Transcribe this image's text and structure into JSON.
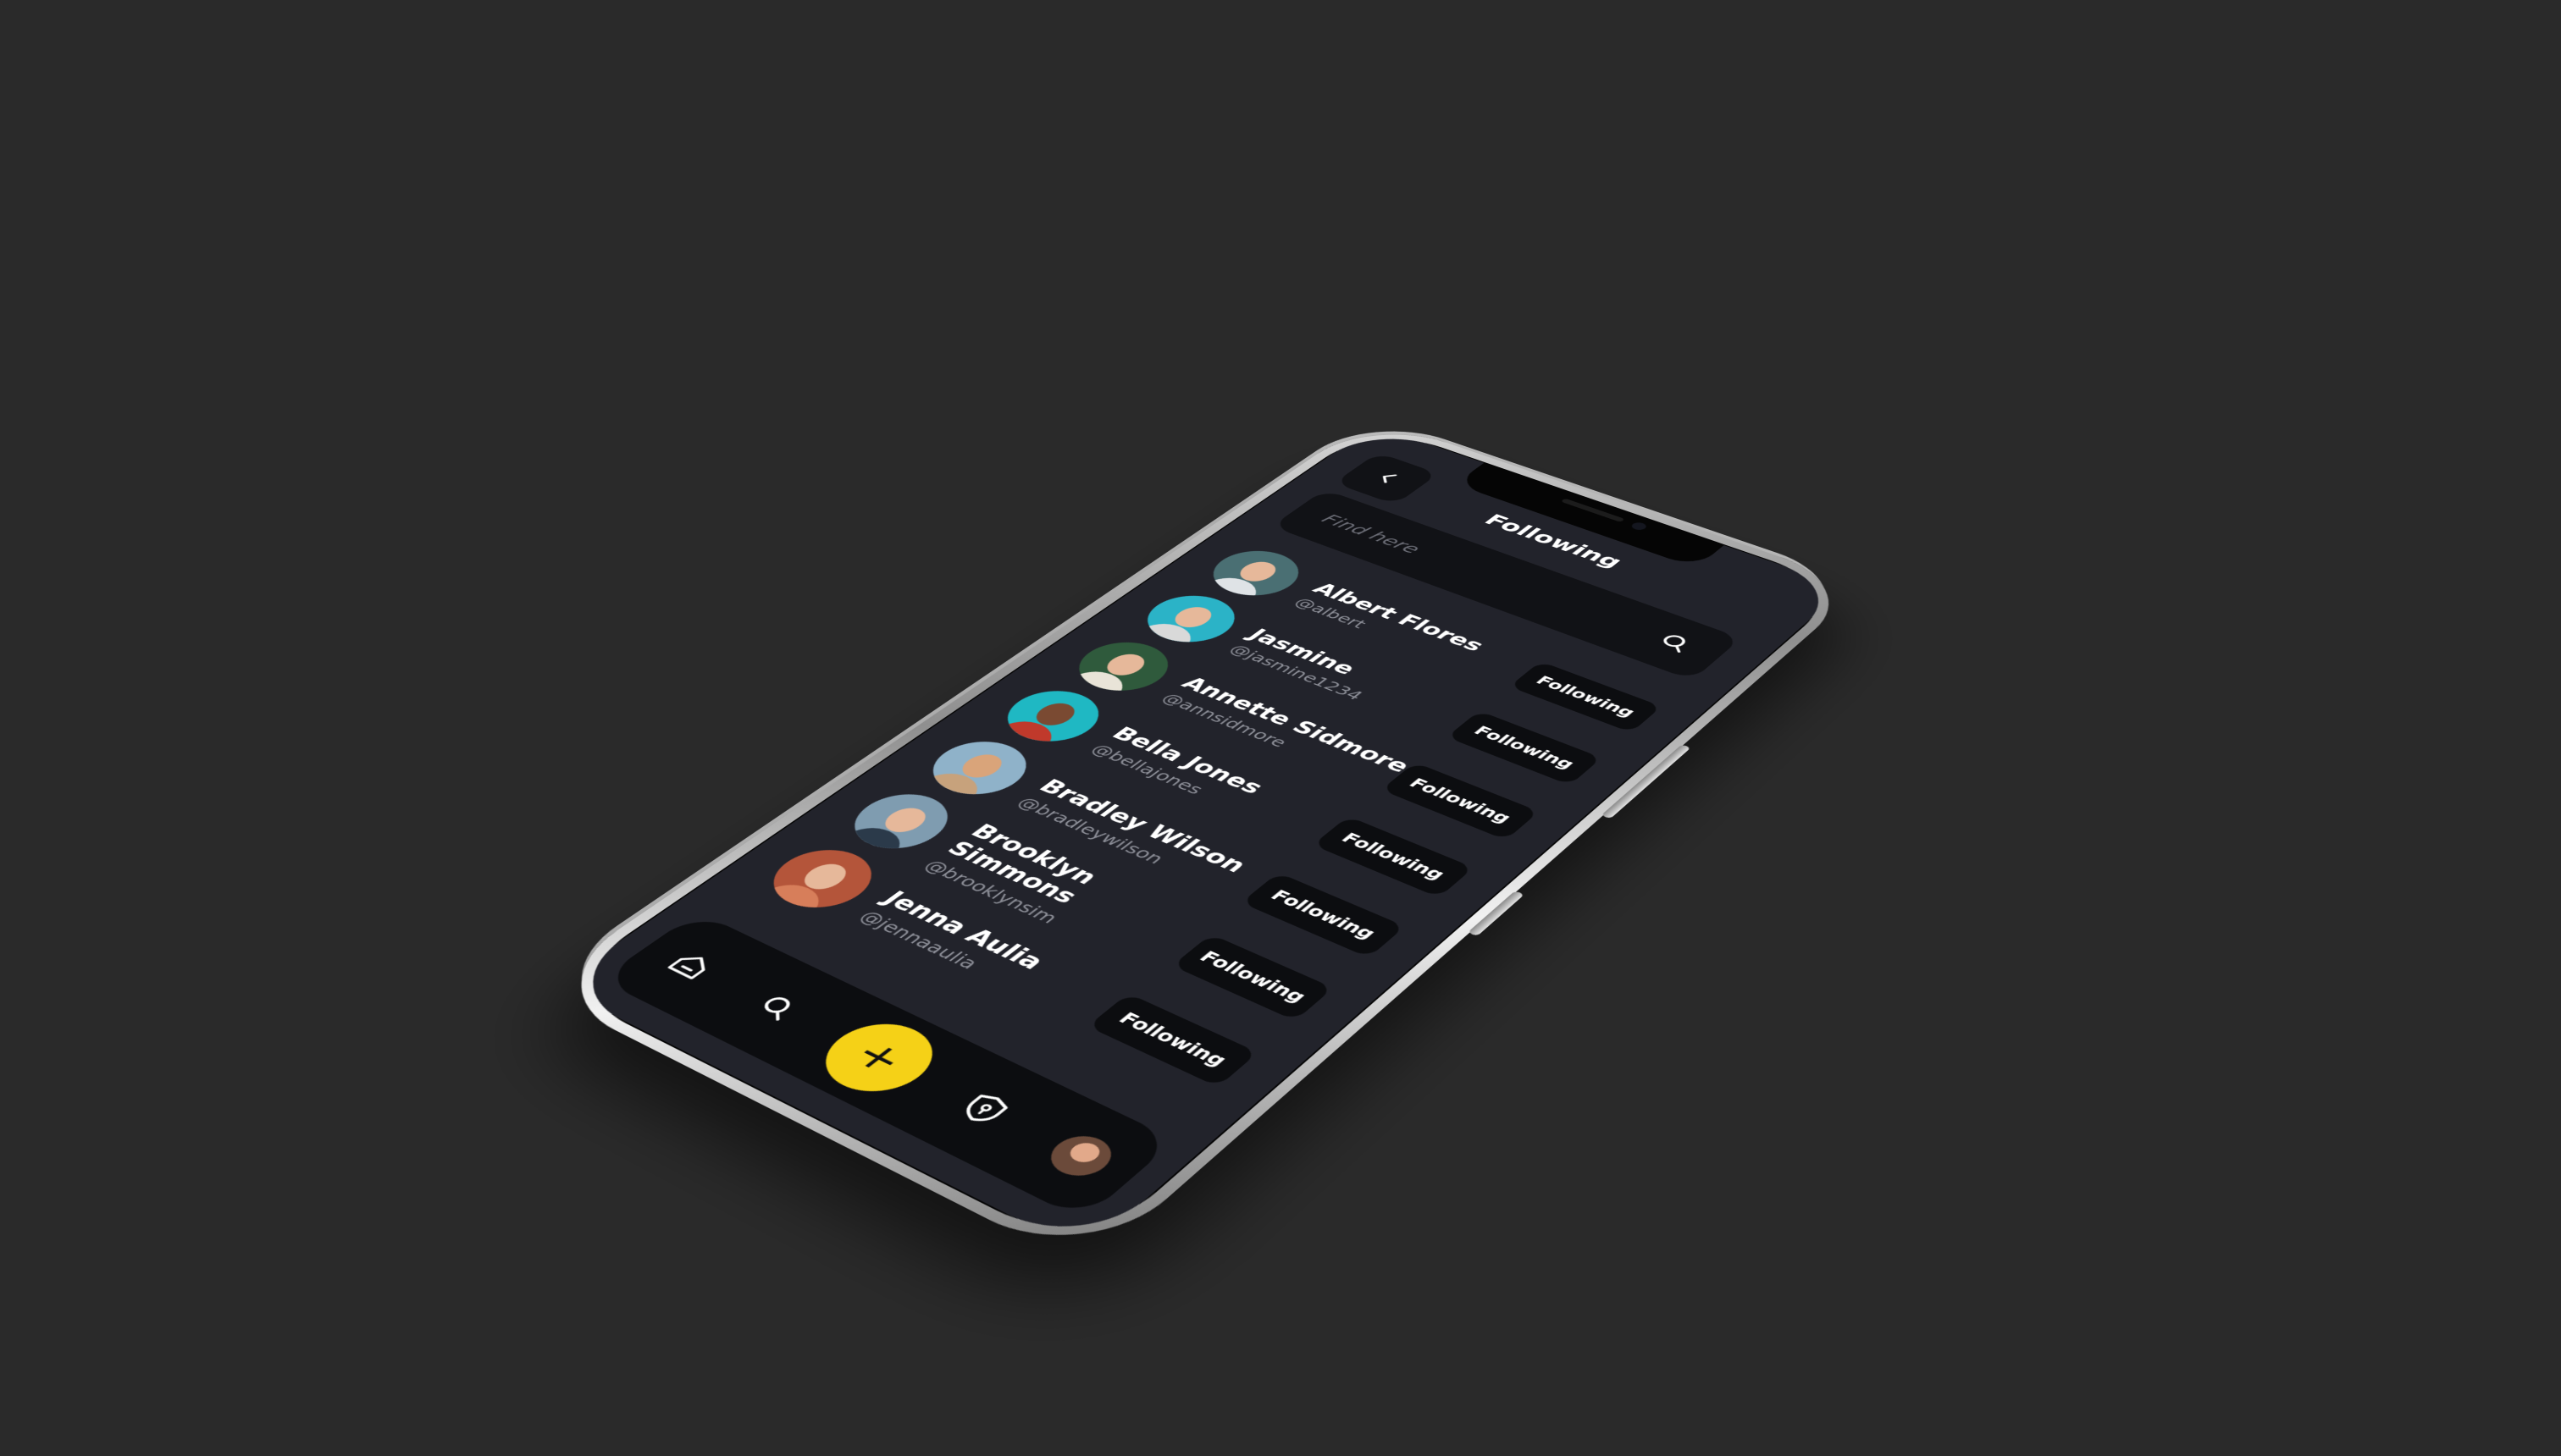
{
  "header": {
    "title": "Following",
    "back_label": "<"
  },
  "search": {
    "placeholder": "Find here"
  },
  "users": [
    {
      "name": "Albert Flores",
      "handle": "@albert",
      "button": "Following",
      "bg": "#4a6f73",
      "shirt": "#dfe3e6"
    },
    {
      "name": "Jasmine",
      "handle": "@jasmine1234",
      "button": "Following",
      "bg": "#2bb3c7",
      "shirt": "#d9d9d9"
    },
    {
      "name": "Annette Sidmore",
      "handle": "@annsidmore",
      "button": "Following",
      "bg": "#2f5a3c",
      "shirt": "#e9e4d8"
    },
    {
      "name": "Bella Jones",
      "handle": "@bellajones",
      "button": "Following",
      "bg": "#1fb8c3",
      "shirt": "#c0392b"
    },
    {
      "name": "Bradley Wilson",
      "handle": "@bradleywilson",
      "button": "Following",
      "bg": "#8fb2c9",
      "shirt": "#c7a27c"
    },
    {
      "name": "Brooklyn Simmons",
      "handle": "@brooklynsim",
      "button": "Following",
      "bg": "#7f9cb0",
      "shirt": "#2b3a4a"
    },
    {
      "name": "Jenna Aulia",
      "handle": "@jennaaulia",
      "button": "Following",
      "bg": "#b4553a",
      "shirt": "#d77e5a"
    }
  ],
  "tabbar": {
    "add_label": "+",
    "icons": [
      "home-icon",
      "search-icon",
      "add-icon",
      "shield-icon",
      "profile-avatar"
    ]
  },
  "colors": {
    "background": "#2a2a2a",
    "screen": "#22232b",
    "card": "#111216",
    "accent": "#f5d117"
  }
}
